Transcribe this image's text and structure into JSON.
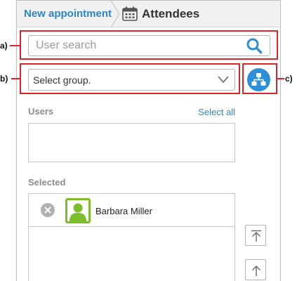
{
  "header": {
    "breadcrumb_link": "New appointment",
    "title": "Attendees",
    "title_icon": "calendar-icon"
  },
  "search": {
    "placeholder": "User search",
    "value": "",
    "icon": "search-icon"
  },
  "group_select": {
    "selected": "Select group.",
    "icon": "chevron-down-icon"
  },
  "org_button": {
    "icon": "org-chart-icon"
  },
  "users": {
    "label": "Users",
    "select_all": "Select all",
    "items": []
  },
  "selected": {
    "label": "Selected",
    "items": [
      {
        "name": "Barbara Miller",
        "avatar_icon": "user-avatar-icon",
        "remove_icon": "remove-icon"
      }
    ]
  },
  "move_buttons": {
    "top_icon": "move-to-top-icon",
    "up_icon": "move-up-icon"
  },
  "callouts": {
    "a": "a)",
    "b": "b)",
    "c": "c)"
  },
  "colors": {
    "accent": "#2b86c5",
    "org_button": "#2e8ed6",
    "avatar": "#7bbd2a",
    "callout": "#d9252b",
    "section_label": "#8c8c8c"
  }
}
